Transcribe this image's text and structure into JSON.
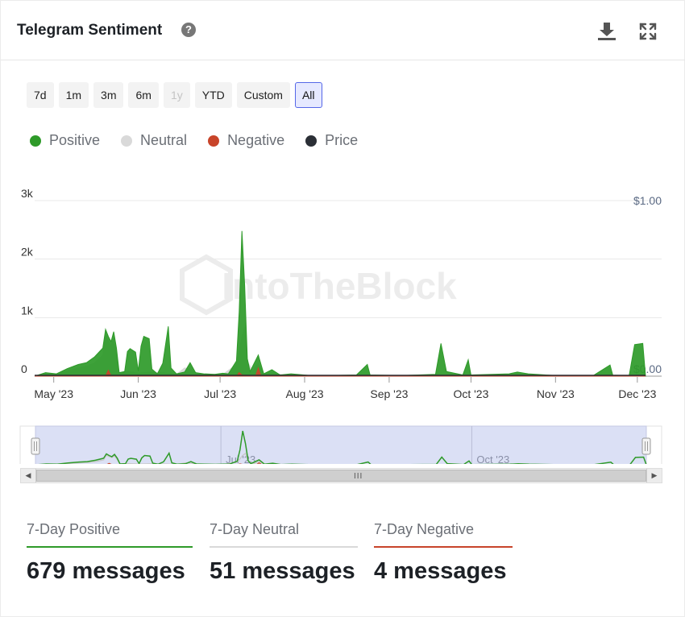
{
  "header": {
    "title": "Telegram Sentiment",
    "help_icon": "question-circle-icon",
    "download_icon": "download-icon",
    "expand_icon": "expand-icon"
  },
  "ranges": [
    {
      "label": "7d",
      "state": "normal"
    },
    {
      "label": "1m",
      "state": "normal"
    },
    {
      "label": "3m",
      "state": "normal"
    },
    {
      "label": "6m",
      "state": "normal"
    },
    {
      "label": "1y",
      "state": "disabled"
    },
    {
      "label": "YTD",
      "state": "normal"
    },
    {
      "label": "Custom",
      "state": "normal"
    },
    {
      "label": "All",
      "state": "active"
    }
  ],
  "legend": [
    {
      "label": "Positive",
      "color": "#2e9a29"
    },
    {
      "label": "Neutral",
      "color": "#d9d9d9"
    },
    {
      "label": "Negative",
      "color": "#c8442a"
    },
    {
      "label": "Price",
      "color": "#2b2f36"
    }
  ],
  "watermark": "IntoTheBlock",
  "chart_data": {
    "type": "area",
    "y_left_ticks": [
      "0",
      "1k",
      "2k",
      "3k"
    ],
    "y_right_ticks": [
      "$0.00",
      "$1.00"
    ],
    "ylim_left": [
      0,
      3000
    ],
    "ylim_right": [
      0,
      1
    ],
    "x_ticks": [
      "May '23",
      "Jun '23",
      "Jul '23",
      "Aug '23",
      "Sep '23",
      "Oct '23",
      "Nov '23",
      "Dec '23"
    ],
    "navigator_labels": [
      "Jul '23",
      "Oct '23"
    ],
    "grid": true,
    "legend_position": "top-left",
    "series": [
      {
        "name": "Positive",
        "color": "#2e9a29",
        "points": [
          [
            "2023-04-24",
            0
          ],
          [
            "2023-04-28",
            60
          ],
          [
            "2023-05-02",
            40
          ],
          [
            "2023-05-06",
            130
          ],
          [
            "2023-05-10",
            200
          ],
          [
            "2023-05-13",
            230
          ],
          [
            "2023-05-16",
            330
          ],
          [
            "2023-05-19",
            480
          ],
          [
            "2023-05-20",
            800
          ],
          [
            "2023-05-21",
            680
          ],
          [
            "2023-05-22",
            590
          ],
          [
            "2023-05-23",
            760
          ],
          [
            "2023-05-24",
            480
          ],
          [
            "2023-05-25",
            60
          ],
          [
            "2023-05-27",
            80
          ],
          [
            "2023-05-28",
            420
          ],
          [
            "2023-05-29",
            470
          ],
          [
            "2023-05-31",
            410
          ],
          [
            "2023-06-01",
            90
          ],
          [
            "2023-06-02",
            510
          ],
          [
            "2023-06-03",
            680
          ],
          [
            "2023-06-05",
            640
          ],
          [
            "2023-06-06",
            120
          ],
          [
            "2023-06-08",
            40
          ],
          [
            "2023-06-10",
            220
          ],
          [
            "2023-06-12",
            850
          ],
          [
            "2023-06-13",
            140
          ],
          [
            "2023-06-15",
            40
          ],
          [
            "2023-06-18",
            70
          ],
          [
            "2023-06-20",
            230
          ],
          [
            "2023-06-22",
            60
          ],
          [
            "2023-06-25",
            40
          ],
          [
            "2023-06-29",
            30
          ],
          [
            "2023-07-02",
            50
          ],
          [
            "2023-07-04",
            40
          ],
          [
            "2023-07-07",
            260
          ],
          [
            "2023-07-08",
            1100
          ],
          [
            "2023-07-09",
            2480
          ],
          [
            "2023-07-10",
            1550
          ],
          [
            "2023-07-11",
            300
          ],
          [
            "2023-07-12",
            80
          ],
          [
            "2023-07-15",
            360
          ],
          [
            "2023-07-17",
            40
          ],
          [
            "2023-07-20",
            110
          ],
          [
            "2023-07-23",
            20
          ],
          [
            "2023-07-27",
            40
          ],
          [
            "2023-08-02",
            15
          ],
          [
            "2023-08-10",
            10
          ],
          [
            "2023-08-20",
            20
          ],
          [
            "2023-08-24",
            200
          ],
          [
            "2023-08-25",
            20
          ],
          [
            "2023-09-05",
            10
          ],
          [
            "2023-09-18",
            30
          ],
          [
            "2023-09-20",
            560
          ],
          [
            "2023-09-22",
            80
          ],
          [
            "2023-09-28",
            20
          ],
          [
            "2023-09-30",
            280
          ],
          [
            "2023-10-01",
            20
          ],
          [
            "2023-10-15",
            40
          ],
          [
            "2023-10-18",
            70
          ],
          [
            "2023-10-22",
            40
          ],
          [
            "2023-11-01",
            10
          ],
          [
            "2023-11-15",
            15
          ],
          [
            "2023-11-21",
            190
          ],
          [
            "2023-11-22",
            15
          ],
          [
            "2023-11-28",
            10
          ],
          [
            "2023-11-30",
            540
          ],
          [
            "2023-12-03",
            560
          ],
          [
            "2023-12-04",
            0
          ]
        ]
      },
      {
        "name": "Neutral",
        "color": "#d9d9d9",
        "points": [
          [
            "2023-04-24",
            0
          ],
          [
            "2023-04-28",
            40
          ],
          [
            "2023-05-02",
            30
          ],
          [
            "2023-05-06",
            90
          ],
          [
            "2023-05-10",
            140
          ],
          [
            "2023-05-13",
            170
          ],
          [
            "2023-05-16",
            230
          ],
          [
            "2023-05-19",
            360
          ],
          [
            "2023-05-20",
            700
          ],
          [
            "2023-05-21",
            600
          ],
          [
            "2023-05-22",
            520
          ],
          [
            "2023-05-23",
            650
          ],
          [
            "2023-05-24",
            380
          ],
          [
            "2023-05-25",
            40
          ],
          [
            "2023-05-28",
            90
          ],
          [
            "2023-06-01",
            50
          ],
          [
            "2023-06-05",
            70
          ],
          [
            "2023-06-10",
            60
          ],
          [
            "2023-06-15",
            30
          ],
          [
            "2023-06-18",
            140
          ],
          [
            "2023-06-20",
            120
          ],
          [
            "2023-06-23",
            40
          ],
          [
            "2023-07-02",
            30
          ],
          [
            "2023-07-07",
            200
          ],
          [
            "2023-07-09",
            680
          ],
          [
            "2023-07-10",
            840
          ],
          [
            "2023-07-11",
            260
          ],
          [
            "2023-07-13",
            80
          ],
          [
            "2023-07-15",
            230
          ],
          [
            "2023-07-17",
            30
          ],
          [
            "2023-07-20",
            60
          ],
          [
            "2023-07-25",
            10
          ],
          [
            "2023-12-04",
            0
          ]
        ]
      },
      {
        "name": "Negative",
        "color": "#c8442a",
        "points": [
          [
            "2023-04-24",
            0
          ],
          [
            "2023-05-20",
            0
          ],
          [
            "2023-05-21",
            100
          ],
          [
            "2023-05-22",
            10
          ],
          [
            "2023-07-07",
            0
          ],
          [
            "2023-07-08",
            60
          ],
          [
            "2023-07-09",
            20
          ],
          [
            "2023-07-14",
            0
          ],
          [
            "2023-07-15",
            140
          ],
          [
            "2023-07-16",
            0
          ],
          [
            "2023-12-04",
            0
          ]
        ]
      },
      {
        "name": "Price",
        "color": "#2b2f36",
        "points": [
          [
            "2023-04-24",
            0.0
          ],
          [
            "2023-12-04",
            0.0
          ]
        ]
      }
    ]
  },
  "scrollbar": {
    "left_arrow": "arrow-left-icon",
    "right_arrow": "arrow-right-icon",
    "grip": "III"
  },
  "stats": [
    {
      "label": "7-Day Positive",
      "value": "679 messages",
      "color": "#2e9a29"
    },
    {
      "label": "7-Day Neutral",
      "value": "51 messages",
      "color": "#d9d9d9"
    },
    {
      "label": "7-Day Negative",
      "value": "4 messages",
      "color": "#c8442a"
    }
  ]
}
